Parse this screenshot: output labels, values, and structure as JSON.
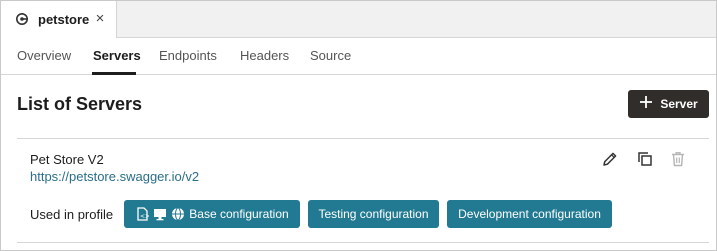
{
  "document_tab": {
    "icon": "api-icon",
    "label": "petstore",
    "close_icon": "close-icon",
    "close_glyph": "×"
  },
  "subnav": {
    "items": [
      {
        "label": "Overview",
        "active": false
      },
      {
        "label": "Servers",
        "active": true
      },
      {
        "label": "Endpoints",
        "active": false
      },
      {
        "label": "Headers",
        "active": false
      },
      {
        "label": "Source",
        "active": false
      }
    ]
  },
  "page": {
    "title": "List of Servers",
    "add_button_label": "Server",
    "add_button_icon": "plus-icon"
  },
  "server": {
    "name": "Pet Store V2",
    "url": "https://petstore.swagger.io/v2",
    "actions": [
      "edit-icon",
      "duplicate-icon",
      "delete-icon"
    ],
    "used_in_label": "Used in profile",
    "profiles": [
      {
        "label": "Base configuration",
        "icons": [
          "document-icon",
          "monitor-icon",
          "globe-icon"
        ]
      },
      {
        "label": "Testing configuration",
        "icons": []
      },
      {
        "label": "Development configuration",
        "icons": []
      }
    ]
  },
  "colors": {
    "chip_bg": "#227a92",
    "primary_button_bg": "#312d2a",
    "link": "#2a6e8a"
  }
}
